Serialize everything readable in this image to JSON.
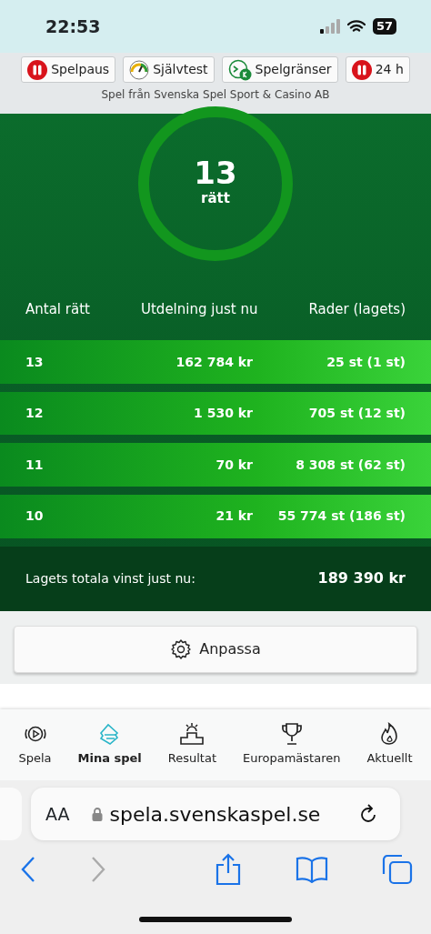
{
  "status_bar": {
    "time": "22:53",
    "battery": "57"
  },
  "responsible_gaming": {
    "buttons": [
      {
        "label": "Spelpaus",
        "kind": "pause"
      },
      {
        "label": "Självtest",
        "kind": "gauge"
      },
      {
        "label": "Spelgränser",
        "kind": "limit"
      },
      {
        "label": "24 h",
        "kind": "pause"
      }
    ],
    "provider": "Spel från Svenska Spel Sport & Casino AB"
  },
  "result": {
    "score": "13",
    "score_label": "rätt"
  },
  "table": {
    "columns": [
      "Antal rätt",
      "Utdelning just nu",
      "Rader (lagets)"
    ],
    "rows": [
      {
        "cells": [
          "13",
          "162 784 kr",
          "25 st (1 st)"
        ]
      },
      {
        "cells": [
          "12",
          "1 530 kr",
          "705 st (12 st)"
        ]
      },
      {
        "cells": [
          "11",
          "70 kr",
          "8 308 st (62 st)"
        ]
      },
      {
        "cells": [
          "10",
          "21 kr",
          "55 774 st (186 st)"
        ]
      }
    ],
    "total_label": "Lagets totala vinst just nu:",
    "total_value": "189 390 kr"
  },
  "customize_button": "Anpassa",
  "bottom_nav": [
    {
      "label": "Spela",
      "kind": "play",
      "selected": false
    },
    {
      "label": "Mina spel",
      "kind": "tickets",
      "selected": true
    },
    {
      "label": "Resultat",
      "kind": "podium",
      "selected": false
    },
    {
      "label": "Europamästaren",
      "kind": "trophy",
      "selected": false
    },
    {
      "label": "Aktuellt",
      "kind": "flame",
      "selected": false
    }
  ],
  "browser": {
    "text_size": "AA",
    "url": "spela.svenskaspel.se"
  }
}
